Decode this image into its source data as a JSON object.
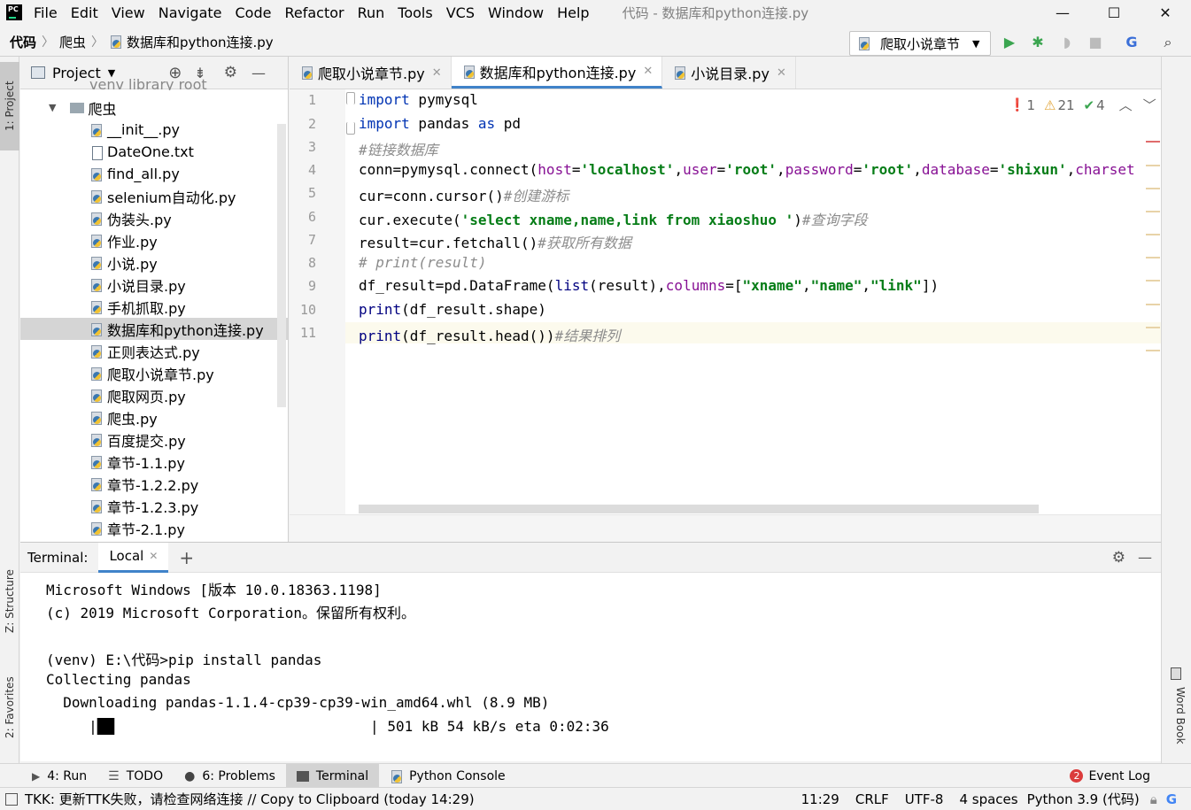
{
  "app": {
    "logo": "PC",
    "window_title": "代码 - 数据库和python连接.py"
  },
  "menu": [
    "File",
    "Edit",
    "View",
    "Navigate",
    "Code",
    "Refactor",
    "Run",
    "Tools",
    "VCS",
    "Window",
    "Help"
  ],
  "window_controls": {
    "minimize": "—",
    "maximize": "☐",
    "close": "✕"
  },
  "breadcrumb": [
    "代码",
    "爬虫",
    "数据库和python连接.py"
  ],
  "run_config": {
    "label": "爬取小说章节",
    "dropdown": "▼"
  },
  "left_tabs": {
    "project": "1: Project",
    "structure": "Z: Structure",
    "favorites": "2: Favorites"
  },
  "right_tabs": {
    "wordbook": "Word Book"
  },
  "project": {
    "title": "Project",
    "items": [
      {
        "label": "venv  library root",
        "type": "folder",
        "indent": 0
      },
      {
        "label": "爬虫",
        "type": "folder",
        "indent": 1
      },
      {
        "label": "__init__.py",
        "type": "py"
      },
      {
        "label": "DateOne.txt",
        "type": "txt"
      },
      {
        "label": "find_all.py",
        "type": "py"
      },
      {
        "label": "selenium自动化.py",
        "type": "py"
      },
      {
        "label": "伪装头.py",
        "type": "py"
      },
      {
        "label": "作业.py",
        "type": "py"
      },
      {
        "label": "小说.py",
        "type": "py"
      },
      {
        "label": "小说目录.py",
        "type": "py"
      },
      {
        "label": "手机抓取.py",
        "type": "py"
      },
      {
        "label": "数据库和python连接.py",
        "type": "py",
        "selected": true
      },
      {
        "label": "正则表达式.py",
        "type": "py"
      },
      {
        "label": "爬取小说章节.py",
        "type": "py"
      },
      {
        "label": "爬取网页.py",
        "type": "py"
      },
      {
        "label": "爬虫.py",
        "type": "py"
      },
      {
        "label": "百度提交.py",
        "type": "py"
      },
      {
        "label": "章节-1.1.py",
        "type": "py"
      },
      {
        "label": "章节-1.2.2.py",
        "type": "py"
      },
      {
        "label": "章节-1.2.3.py",
        "type": "py"
      },
      {
        "label": "章节-2.1.py",
        "type": "py"
      }
    ]
  },
  "editor_tabs": [
    {
      "label": "爬取小说章节.py",
      "active": false
    },
    {
      "label": "数据库和python连接.py",
      "active": true
    },
    {
      "label": "小说目录.py",
      "active": false
    }
  ],
  "inspections": {
    "errors": "1",
    "warnings": "21",
    "weak": "4"
  },
  "code_lines": [
    "1",
    "2",
    "3",
    "4",
    "5",
    "6",
    "7",
    "8",
    "9",
    "10",
    "11"
  ],
  "code": {
    "l1": {
      "kw": "import",
      "rest": " pymysql"
    },
    "l2": {
      "kw1": "import",
      "mid": " pandas ",
      "kw2": "as",
      "rest": " pd"
    },
    "l3": {
      "com": "#链接数据库"
    },
    "l4": {
      "a": "conn=pymysql.connect(",
      "p1": "host",
      "e1": "=",
      "s1": "'localhost'",
      "c1": ",",
      "p2": "user",
      "e2": "=",
      "s2": "'root'",
      "c2": ",",
      "p3": "password",
      "e3": "=",
      "s3": "'root'",
      "c3": ",",
      "p4": "database",
      "e4": "=",
      "s4": "'shixun'",
      "c4": ",",
      "p5": "charset"
    },
    "l5": {
      "a": "cur=conn.cursor()",
      "com": "#创建游标"
    },
    "l6": {
      "a": "cur.execute(",
      "s": "'select xname,name,link from xiaoshuo '",
      "b": ")",
      "com": "#查询字段"
    },
    "l7": {
      "a": "result=cur.fetchall()",
      "com": "#获取所有数据"
    },
    "l8": {
      "com": "# print(result)"
    },
    "l9": {
      "a": "df_result=pd.DataFrame(",
      "f": "list",
      "b": "(result),",
      "p": "columns",
      "c": "=[",
      "s1": "\"xname\"",
      "d": ",",
      "s2": "\"name\"",
      "e": ",",
      "s3": "\"link\"",
      "g": "])"
    },
    "l10": {
      "f": "print",
      "a": "(df_result.shape)"
    },
    "l11": {
      "f": "print",
      "a": "(df_result.head())",
      "com": "#结果排列"
    }
  },
  "terminal": {
    "label": "Terminal:",
    "tab": "Local",
    "add": "+",
    "lines": [
      "Microsoft Windows [版本 10.0.18363.1198]",
      "(c) 2019 Microsoft Corporation。保留所有权利。",
      "",
      "(venv) E:\\代码>pip install pandas",
      "Collecting pandas",
      "  Downloading pandas-1.1.4-cp39-cp39-win_amd64.whl (8.9 MB)",
      "     |██                              | 501 kB 54 kB/s eta 0:02:36"
    ]
  },
  "tool_windows": [
    {
      "label": "4: Run",
      "icon": "run-icon"
    },
    {
      "label": "TODO",
      "icon": "list-icon"
    },
    {
      "label": "6: Problems",
      "icon": "problems-icon"
    },
    {
      "label": "Terminal",
      "icon": "terminal-icon",
      "active": true
    },
    {
      "label": "Python Console",
      "icon": "python-icon"
    }
  ],
  "event_log": {
    "count": "2",
    "label": "Event Log"
  },
  "status": {
    "message": "TKK: 更新TTK失败，请检查网络连接 // Copy to Clipboard (today 14:29)",
    "position": "11:29",
    "line_sep": "CRLF",
    "encoding": "UTF-8",
    "indent": "4 spaces",
    "interpreter": "Python 3.9 (代码)"
  },
  "colors": {
    "accent": "#4083c9",
    "run_green": "#3ba550",
    "keyword": "#0033b3",
    "string": "#067d17",
    "comment": "#8c8c8c",
    "param": "#871094",
    "error": "#db3b3b"
  }
}
